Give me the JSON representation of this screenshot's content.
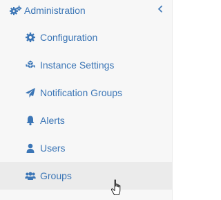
{
  "sidebar": {
    "section": {
      "label": "Administration",
      "icon": "cogs-icon",
      "toggle_icon": "chevron-left-icon"
    },
    "items": [
      {
        "label": "Configuration",
        "icon": "gear-icon"
      },
      {
        "label": "Instance Settings",
        "icon": "cubes-icon"
      },
      {
        "label": "Notification Groups",
        "icon": "paper-plane-icon"
      },
      {
        "label": "Alerts",
        "icon": "bell-icon"
      },
      {
        "label": "Users",
        "icon": "user-icon"
      },
      {
        "label": "Groups",
        "icon": "users-icon",
        "active": true
      }
    ]
  },
  "colors": {
    "accent": "#3c76b6",
    "sidebar_bg": "#f7f7f7",
    "active_bg": "#ebebeb"
  },
  "cursor": {
    "icon": "hand-pointer-cursor"
  }
}
